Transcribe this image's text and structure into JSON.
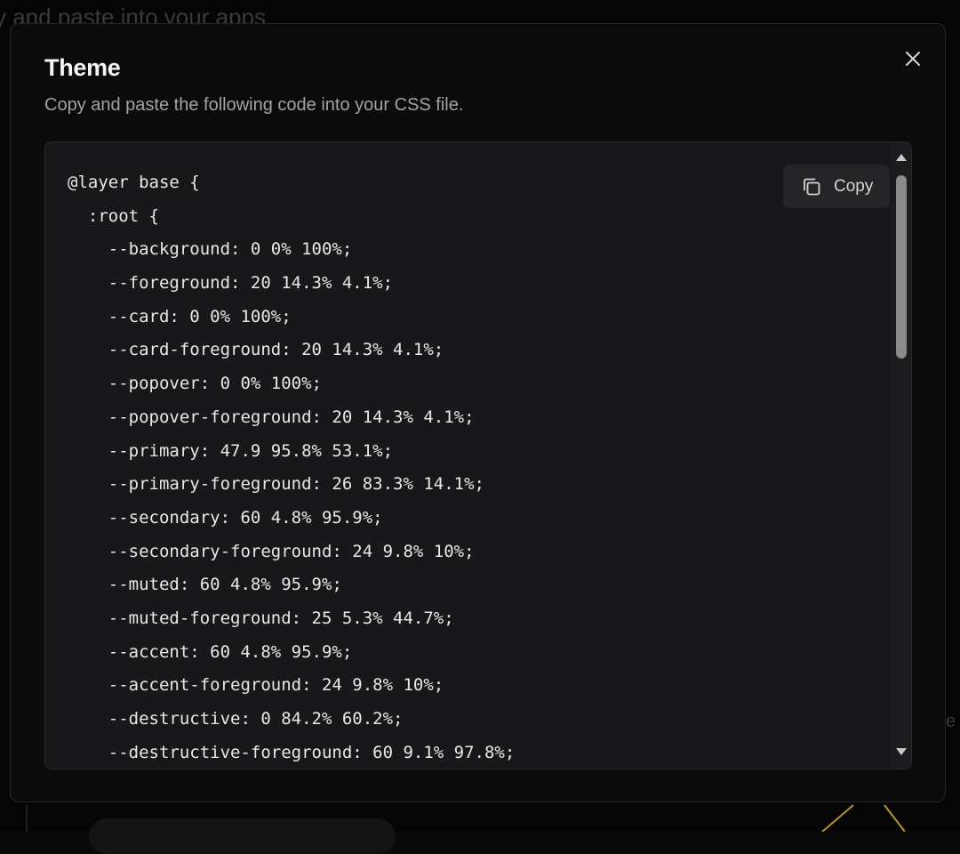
{
  "background": {
    "partial_text": "y and paste into your apps",
    "right_edge_text": "e"
  },
  "dialog": {
    "title": "Theme",
    "description": "Copy and paste the following code into your CSS file.",
    "close_icon": "x-icon",
    "copy_button": {
      "label": "Copy",
      "icon": "copy-icon"
    },
    "code_lines": [
      "@layer base {",
      "  :root {",
      "    --background: 0 0% 100%;",
      "    --foreground: 20 14.3% 4.1%;",
      "    --card: 0 0% 100%;",
      "    --card-foreground: 20 14.3% 4.1%;",
      "    --popover: 0 0% 100%;",
      "    --popover-foreground: 20 14.3% 4.1%;",
      "    --primary: 47.9 95.8% 53.1%;",
      "    --primary-foreground: 26 83.3% 14.1%;",
      "    --secondary: 60 4.8% 95.9%;",
      "    --secondary-foreground: 24 9.8% 10%;",
      "    --muted: 60 4.8% 95.9%;",
      "    --muted-foreground: 25 5.3% 44.7%;",
      "    --accent: 60 4.8% 95.9%;",
      "    --accent-foreground: 24 9.8% 10%;",
      "    --destructive: 0 84.2% 60.2%;",
      "    --destructive-foreground: 60 9.1% 97.8%;"
    ]
  },
  "colors": {
    "modal_bg": "#0b0b0b",
    "code_bg": "#18181a",
    "title": "#f5f5f5",
    "muted_text": "#a3a3a3",
    "accent_bg_line": "#b8922c"
  }
}
